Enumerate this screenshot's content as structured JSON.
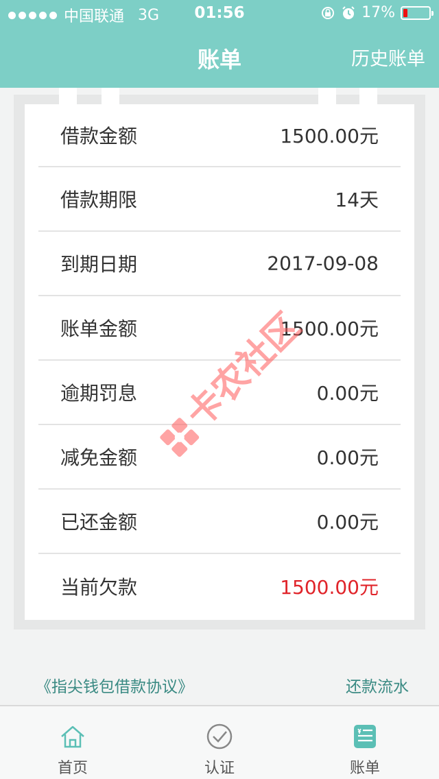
{
  "status_bar": {
    "carrier": "中国联通",
    "network": "3G",
    "time": "01:56",
    "battery": "17%",
    "battery_level": 0.17
  },
  "nav": {
    "title": "账单",
    "history_label": "历史账单"
  },
  "bill": {
    "rows": [
      {
        "label": "借款金额",
        "value": "1500.00元"
      },
      {
        "label": "借款期限",
        "value": "14天"
      },
      {
        "label": "到期日期",
        "value": "2017-09-08"
      },
      {
        "label": "账单金额",
        "value": "1500.00元"
      },
      {
        "label": "逾期罚息",
        "value": "0.00元"
      },
      {
        "label": "减免金额",
        "value": "0.00元"
      },
      {
        "label": "已还金额",
        "value": "0.00元"
      },
      {
        "label": "当前欠款",
        "value": "1500.00元",
        "highlight": true
      }
    ]
  },
  "watermark": "卡农社区",
  "links": {
    "agreement": "《指尖钱包借款协议》",
    "repayment_flow": "还款流水"
  },
  "tabbar": {
    "tabs": [
      {
        "label": "首页",
        "icon": "home-icon"
      },
      {
        "label": "认证",
        "icon": "check-circle-icon"
      },
      {
        "label": "账单",
        "icon": "bill-icon",
        "active": true
      }
    ]
  },
  "colors": {
    "accent": "#7dcfc6",
    "highlight": "#e0242a",
    "link": "#3a8a83",
    "battery_low": "#ee1111"
  }
}
